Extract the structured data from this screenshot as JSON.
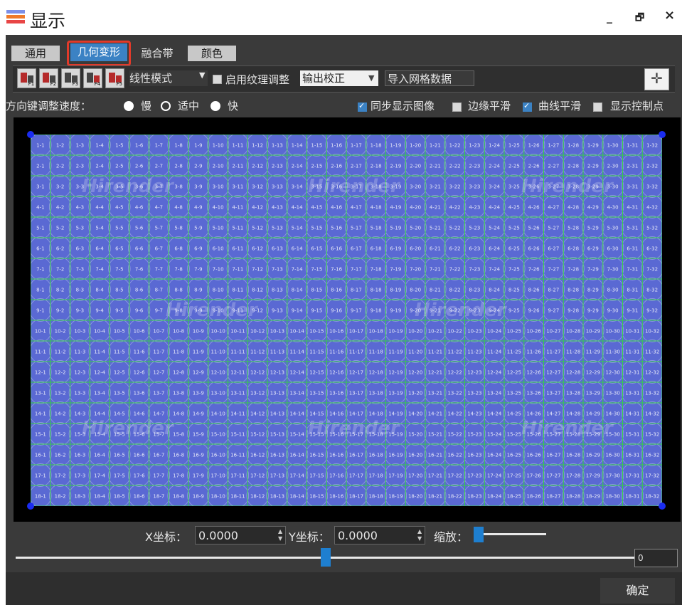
{
  "window": {
    "title": "显示",
    "minimize": "_",
    "restore": "🗗",
    "close": "×"
  },
  "tabs": [
    {
      "label": "通用"
    },
    {
      "label": "几何变形"
    },
    {
      "label": "融合带"
    },
    {
      "label": "颜色"
    }
  ],
  "toolbar": {
    "buttons": [
      "F1",
      "F2",
      "F3",
      "F4",
      "F5"
    ],
    "mode_select": "线性模式",
    "texture_adjust_label": "启用纹理调整",
    "output_select": "输出校正",
    "import_button": "导入网格数据"
  },
  "speed": {
    "label": "方向键调整速度：",
    "options": [
      "慢",
      "适中",
      "快"
    ]
  },
  "options": {
    "sync_display": "同步显示图像",
    "edge_smooth": "边缘平滑",
    "curve_smooth": "曲线平滑",
    "show_control_points": "显示控制点"
  },
  "grid": {
    "rows": 18,
    "cols": 32,
    "fill_color": "#5a69d3",
    "line_color": "#37d04a",
    "corner_color": "#1a2cf0",
    "watermark": "Hirender"
  },
  "coords": {
    "x_label": "X坐标：",
    "x_value": "0.0000",
    "y_label": "Y坐标：",
    "y_value": "0.0000",
    "zoom_label": "缩放："
  },
  "bottom_value": "0",
  "ok_button": "确定"
}
